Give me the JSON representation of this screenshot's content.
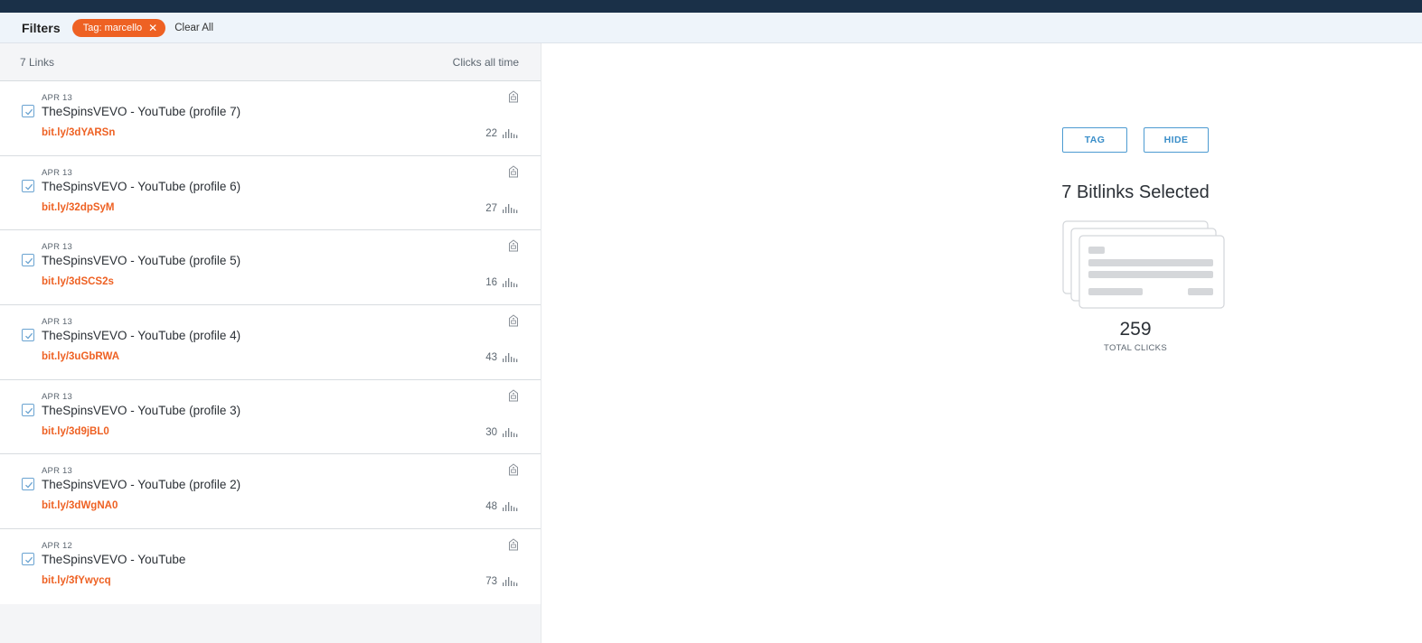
{
  "filters": {
    "label": "Filters",
    "tag_chip": "Tag: marcello",
    "clear_all": "Clear All"
  },
  "list": {
    "count_label": "7 Links",
    "clicks_label": "Clicks all time",
    "rows": [
      {
        "date": "APR 13",
        "title": "TheSpinsVEVO - YouTube (profile 7)",
        "link": "bit.ly/3dYARSn",
        "clicks": "22"
      },
      {
        "date": "APR 13",
        "title": "TheSpinsVEVO - YouTube (profile 6)",
        "link": "bit.ly/32dpSyM",
        "clicks": "27"
      },
      {
        "date": "APR 13",
        "title": "TheSpinsVEVO - YouTube (profile 5)",
        "link": "bit.ly/3dSCS2s",
        "clicks": "16"
      },
      {
        "date": "APR 13",
        "title": "TheSpinsVEVO - YouTube (profile 4)",
        "link": "bit.ly/3uGbRWA",
        "clicks": "43"
      },
      {
        "date": "APR 13",
        "title": "TheSpinsVEVO - YouTube (profile 3)",
        "link": "bit.ly/3d9jBL0",
        "clicks": "30"
      },
      {
        "date": "APR 13",
        "title": "TheSpinsVEVO - YouTube (profile 2)",
        "link": "bit.ly/3dWgNA0",
        "clicks": "48"
      },
      {
        "date": "APR 12",
        "title": "TheSpinsVEVO - YouTube",
        "link": "bit.ly/3fYwycq",
        "clicks": "73"
      }
    ]
  },
  "selection": {
    "tag_button": "TAG",
    "hide_button": "HIDE",
    "title": "7 Bitlinks Selected",
    "total_clicks": "259",
    "total_clicks_label": "TOTAL CLICKS"
  },
  "icons": {
    "remove_tag": "close-icon",
    "row_tag": "tag-icon",
    "row_clicks": "bar-chart-icon",
    "checkbox": "checkmark-icon",
    "illustration": "stacked-cards-illustration"
  },
  "colors": {
    "accent": "#ee6123",
    "topbar": "#1a3048",
    "button_blue": "#3a8ec9",
    "checkbox_blue": "#6aa3d1"
  }
}
